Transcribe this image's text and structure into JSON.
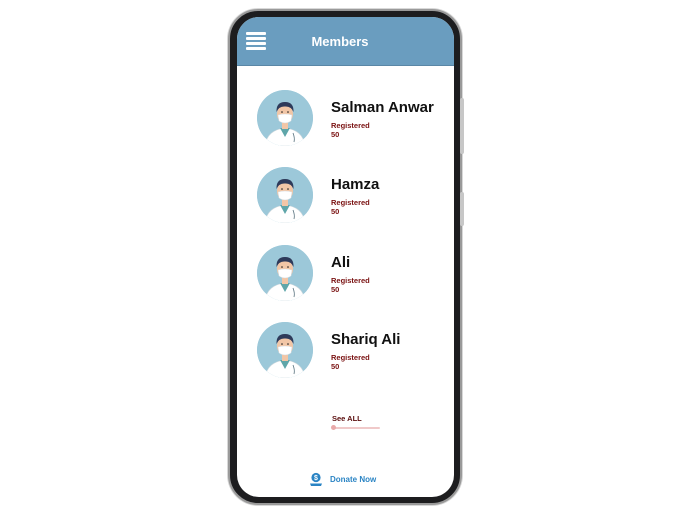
{
  "header": {
    "title": "Members",
    "menu_icon": "hamburger-menu-icon",
    "color": "#6a9dbf"
  },
  "members": [
    {
      "name": "Salman Anwar",
      "status": "Registered",
      "count": "50",
      "avatar": "doctor-avatar-icon"
    },
    {
      "name": "Hamza",
      "status": "Registered",
      "count": "50",
      "avatar": "doctor-avatar-icon"
    },
    {
      "name": "Ali",
      "status": "Registered",
      "count": "50",
      "avatar": "doctor-avatar-icon"
    },
    {
      "name": "Shariq Ali",
      "status": "Registered",
      "count": "50",
      "avatar": "doctor-avatar-icon"
    }
  ],
  "see_all": {
    "label": "See ALL"
  },
  "footer": {
    "donate_label": "Donate Now",
    "donate_icon": "donation-icon",
    "color": "#2a84c4"
  },
  "colors": {
    "status_text": "#7a1212",
    "avatar_bg": "#9cc8d9"
  }
}
